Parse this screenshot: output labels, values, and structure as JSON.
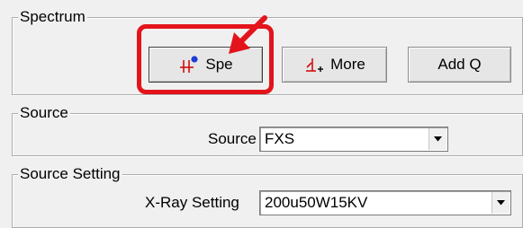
{
  "spectrum": {
    "title": "Spectrum",
    "buttons": {
      "spe": {
        "label": "Spe",
        "icon": "spectrum-plot-icon"
      },
      "more": {
        "label": "More",
        "icon": "peak-add-icon"
      },
      "add_q": {
        "label": "Add Q"
      }
    }
  },
  "source": {
    "title": "Source",
    "field_label": "Source",
    "value": "FXS"
  },
  "source_setting": {
    "title": "Source Setting",
    "field_label": "X-Ray Setting",
    "value": "200u50W15KV"
  },
  "annotation": {
    "highlight_color": "#e3141b"
  }
}
